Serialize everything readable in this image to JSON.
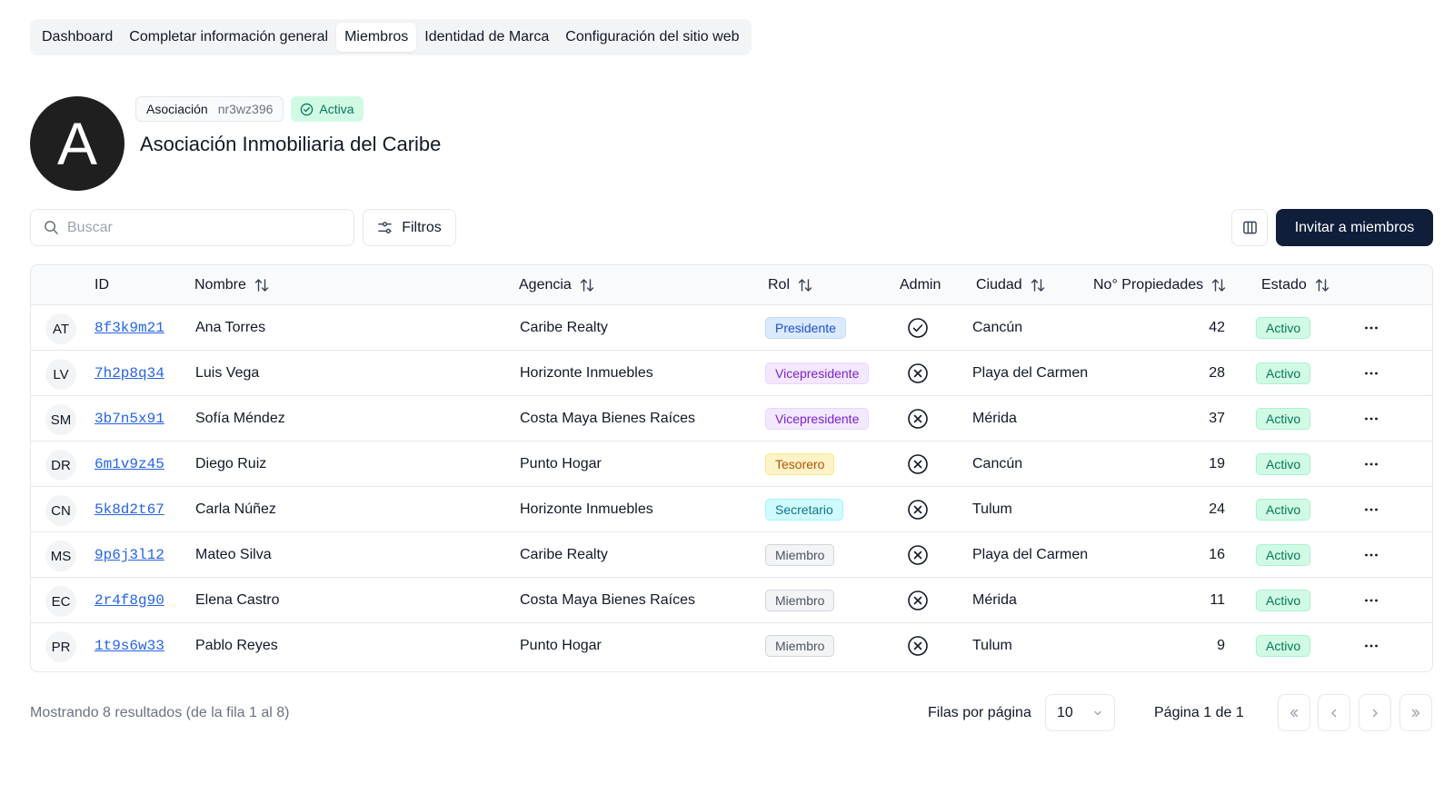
{
  "tabs": [
    {
      "label": "Dashboard",
      "active": false
    },
    {
      "label": "Completar información general",
      "active": false
    },
    {
      "label": "Miembros",
      "active": true
    },
    {
      "label": "Identidad de Marca",
      "active": false
    },
    {
      "label": "Configuración del sitio web",
      "active": false
    }
  ],
  "org": {
    "avatar_letter": "A",
    "type_label": "Asociación",
    "code": "nr3wz396",
    "status": "Activa",
    "name": "Asociación Inmobiliaria del Caribe"
  },
  "toolbar": {
    "search_placeholder": "Buscar",
    "filters_label": "Filtros",
    "invite_label": "Invitar a miembros"
  },
  "table": {
    "headers": {
      "id": "ID",
      "nombre": "Nombre",
      "agencia": "Agencia",
      "rol": "Rol",
      "admin": "Admin",
      "ciudad": "Ciudad",
      "propiedades": "No° Propiedades",
      "estado": "Estado"
    },
    "rows": [
      {
        "initials": "AT",
        "id": "8f3k9m21",
        "nombre": "Ana Torres",
        "agencia": "Caribe Realty",
        "rol": "Presidente",
        "admin": true,
        "ciudad": "Cancún",
        "propiedades": "42",
        "estado": "Activo"
      },
      {
        "initials": "LV",
        "id": "7h2p8q34",
        "nombre": "Luis Vega",
        "agencia": "Horizonte Inmuebles",
        "rol": "Vicepresidente",
        "admin": false,
        "ciudad": "Playa del Carmen",
        "propiedades": "28",
        "estado": "Activo"
      },
      {
        "initials": "SM",
        "id": "3b7n5x91",
        "nombre": "Sofía Méndez",
        "agencia": "Costa Maya Bienes Raíces",
        "rol": "Vicepresidente",
        "admin": false,
        "ciudad": "Mérida",
        "propiedades": "37",
        "estado": "Activo"
      },
      {
        "initials": "DR",
        "id": "6m1v9z45",
        "nombre": "Diego Ruiz",
        "agencia": "Punto Hogar",
        "rol": "Tesorero",
        "admin": false,
        "ciudad": "Cancún",
        "propiedades": "19",
        "estado": "Activo"
      },
      {
        "initials": "CN",
        "id": "5k8d2t67",
        "nombre": "Carla Núñez",
        "agencia": "Horizonte Inmuebles",
        "rol": "Secretario",
        "admin": false,
        "ciudad": "Tulum",
        "propiedades": "24",
        "estado": "Activo"
      },
      {
        "initials": "MS",
        "id": "9p6j3l12",
        "nombre": "Mateo Silva",
        "agencia": "Caribe Realty",
        "rol": "Miembro",
        "admin": false,
        "ciudad": "Playa del Carmen",
        "propiedades": "16",
        "estado": "Activo"
      },
      {
        "initials": "EC",
        "id": "2r4f8g90",
        "nombre": "Elena Castro",
        "agencia": "Costa Maya Bienes Raíces",
        "rol": "Miembro",
        "admin": false,
        "ciudad": "Mérida",
        "propiedades": "11",
        "estado": "Activo"
      },
      {
        "initials": "PR",
        "id": "1t9s6w33",
        "nombre": "Pablo Reyes",
        "agencia": "Punto Hogar",
        "rol": "Miembro",
        "admin": false,
        "ciudad": "Tulum",
        "propiedades": "9",
        "estado": "Activo"
      }
    ]
  },
  "role_colors": {
    "Presidente": {
      "bg": "#dbeafe",
      "fg": "#1d4ed8",
      "border": "#bfdbfe"
    },
    "Vicepresidente": {
      "bg": "#f3e8ff",
      "fg": "#7e22ce",
      "border": "#e9d5ff"
    },
    "Tesorero": {
      "bg": "#fef3c7",
      "fg": "#b45309",
      "border": "#fde68a"
    },
    "Secretario": {
      "bg": "#cffafe",
      "fg": "#0e7490",
      "border": "#a5f3fc"
    },
    "Miembro": {
      "bg": "#f3f4f6",
      "fg": "#4b5563",
      "border": "#d1d5db"
    }
  },
  "footer": {
    "result_text": "Mostrando 8 resultados (de la fila 1 al 8)",
    "rows_label": "Filas por página",
    "rows_value": "10",
    "page_label": "Página 1 de 1"
  }
}
